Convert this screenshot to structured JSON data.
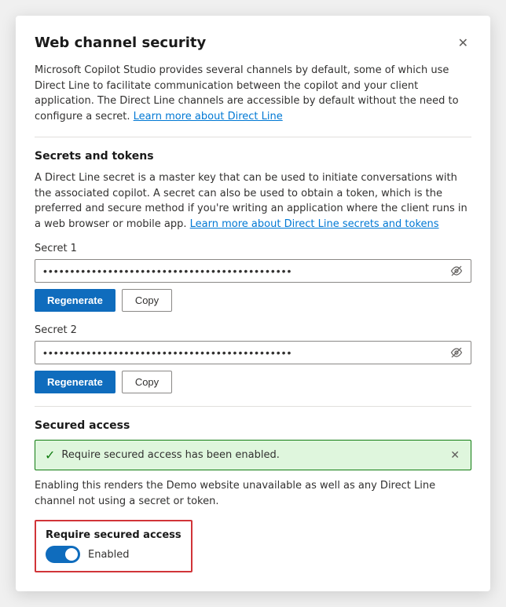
{
  "modal": {
    "title": "Web channel security",
    "close_label": "✕"
  },
  "intro": {
    "description": "Microsoft Copilot Studio provides several channels by default, some of which use Direct Line to facilitate communication between the copilot and your client application. The Direct Line channels are accessible by default without the need to configure a secret.",
    "link_text": "Learn more about Direct Line"
  },
  "secrets_section": {
    "title": "Secrets and tokens",
    "description": "A Direct Line secret is a master key that can be used to initiate conversations with the associated copilot. A secret can also be used to obtain a token, which is the preferred and secure method if you're writing an application where the client runs in a web browser or mobile app.",
    "link_text": "Learn more about Direct Line secrets and tokens",
    "secret1": {
      "label": "Secret 1",
      "value": "••••••••••••••••••••••••••••••••••••••••••••••",
      "regenerate_label": "Regenerate",
      "copy_label": "Copy"
    },
    "secret2": {
      "label": "Secret 2",
      "value": "••••••••••••••••••••••••••••••••••••••••••••••",
      "regenerate_label": "Regenerate",
      "copy_label": "Copy"
    }
  },
  "secured_access": {
    "title": "Secured access",
    "banner_text": "Require secured access has been enabled.",
    "description": "Enabling this renders the Demo website unavailable as well as any Direct Line channel not using a secret or token.",
    "toggle_label": "Require secured access",
    "toggle_state": "Enabled"
  }
}
